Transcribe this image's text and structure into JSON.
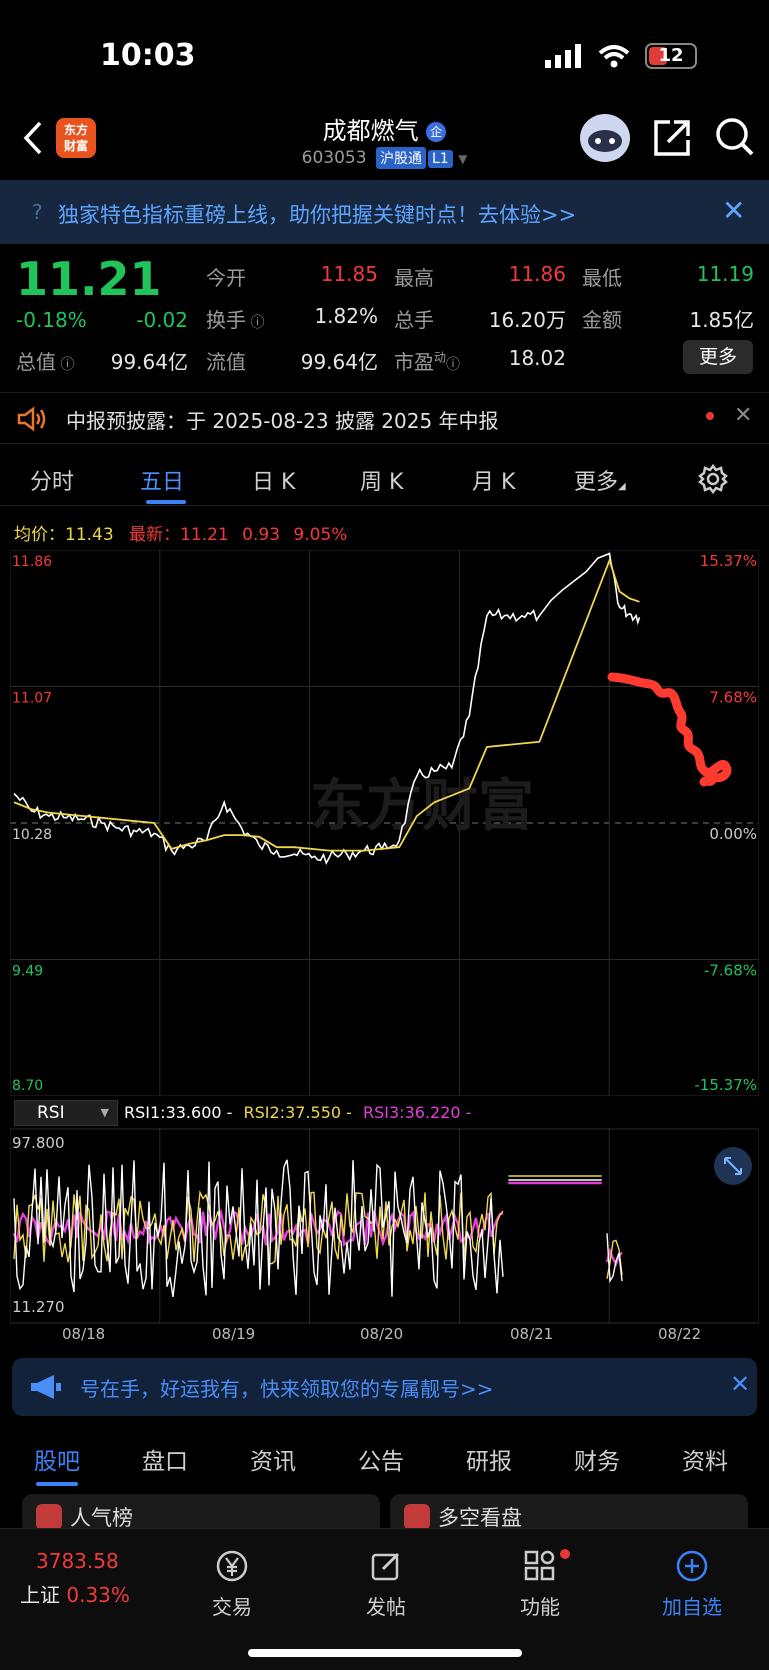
{
  "status_bar": {
    "time": "10:03",
    "battery": "12"
  },
  "header": {
    "logo_text": [
      "东方",
      "财富"
    ],
    "stock_name": "成都燃气",
    "stock_code": "603053",
    "badge1": "沪股通",
    "badge2": "L1"
  },
  "banner": {
    "text": "独家特色指标重磅上线，助你把握关键时点！去体验>>"
  },
  "quote": {
    "price": "11.21",
    "change_pct": "-0.18%",
    "change": "-0.02",
    "open_label": "今开",
    "open": "11.85",
    "high_label": "最高",
    "high": "11.86",
    "low_label": "最低",
    "low": "11.19",
    "turnover_label": "换手",
    "turnover": "1.82%",
    "volume_label": "总手",
    "volume": "16.20万",
    "amount_label": "金额",
    "amount": "1.85亿",
    "mcap_label": "总值",
    "mcap": "99.64亿",
    "float_label": "流值",
    "float": "99.64亿",
    "pe_label": "市盈",
    "pe_sup": "动",
    "pe": "18.02",
    "more_label": "更多"
  },
  "notice": {
    "text": "中报预披露：于 2025-08-23 披露 2025 年中报"
  },
  "chart_tabs": [
    "分时",
    "五日",
    "日 K",
    "周 K",
    "月 K",
    "更多"
  ],
  "avg_row": {
    "avg_label": "均价：",
    "avg": "11.43",
    "latest_label": "最新：",
    "latest": "11.21",
    "chg": "0.93",
    "chg_pct": "9.05%"
  },
  "watermark": "东方财富",
  "chart_data": [
    {
      "type": "line",
      "title": "",
      "y_ticks_left": [
        "11.86",
        "11.07",
        "10.28",
        "9.49",
        "8.70"
      ],
      "y_ticks_right": [
        "15.37%",
        "7.68%",
        "0.00%",
        "-7.68%",
        "-15.37%"
      ],
      "ylim": [
        8.7,
        11.86
      ],
      "x_days": [
        "08/18",
        "08/19",
        "08/20",
        "08/21",
        "08/22"
      ],
      "series": [
        {
          "color": "#ffffff",
          "values": [
            10.45,
            10.35,
            10.32,
            10.31,
            10.3,
            10.28,
            10.25,
            10.23,
            10.22,
            10.12,
            10.15,
            10.18,
            10.4,
            10.25,
            10.15,
            10.12,
            10.1,
            10.08,
            10.08,
            10.1,
            10.12,
            10.13,
            10.18,
            10.55,
            10.58,
            10.6,
            10.9,
            11.48,
            11.48,
            11.48,
            11.48,
            11.84,
            11.53,
            11.49,
            11.47
          ]
        },
        {
          "color": "#f0d64a",
          "values": [
            10.4,
            10.36,
            10.34,
            10.33,
            10.32,
            10.31,
            10.3,
            10.29,
            10.28,
            10.13,
            10.16,
            10.18,
            10.21,
            10.21,
            10.2,
            10.14,
            10.14,
            10.13,
            10.12,
            10.12,
            10.12,
            10.13,
            10.14,
            10.32,
            10.4,
            10.44,
            10.48,
            10.72,
            10.73,
            10.74,
            10.75,
            11.8,
            11.62,
            11.58,
            11.56
          ]
        }
      ]
    },
    {
      "type": "line",
      "title": "",
      "indicator": "RSI",
      "ylim": [
        11.27,
        97.8
      ],
      "y_ticks": [
        "97.800",
        "11.270"
      ],
      "series": [
        {
          "name": "RSI1",
          "label": "RSI1:33.600 -",
          "color": "#ffffff"
        },
        {
          "name": "RSI2",
          "label": "RSI2:37.550 -",
          "color": "#f0d64a"
        },
        {
          "name": "RSI3",
          "label": "RSI3:36.220 -",
          "color": "#e040d8"
        }
      ]
    }
  ],
  "ad": {
    "text": "号在手，好运我有，快来领取您的专属靓号>>"
  },
  "sub_tabs": [
    "股吧",
    "盘口",
    "资讯",
    "公告",
    "研报",
    "财务",
    "资料"
  ],
  "cards": [
    "人气榜",
    "多空看盘"
  ],
  "bottom_nav": {
    "index_value": "3783.58",
    "index_name": "上证",
    "index_change": "0.33%",
    "items": [
      "交易",
      "发帖",
      "功能",
      "加自选"
    ]
  }
}
